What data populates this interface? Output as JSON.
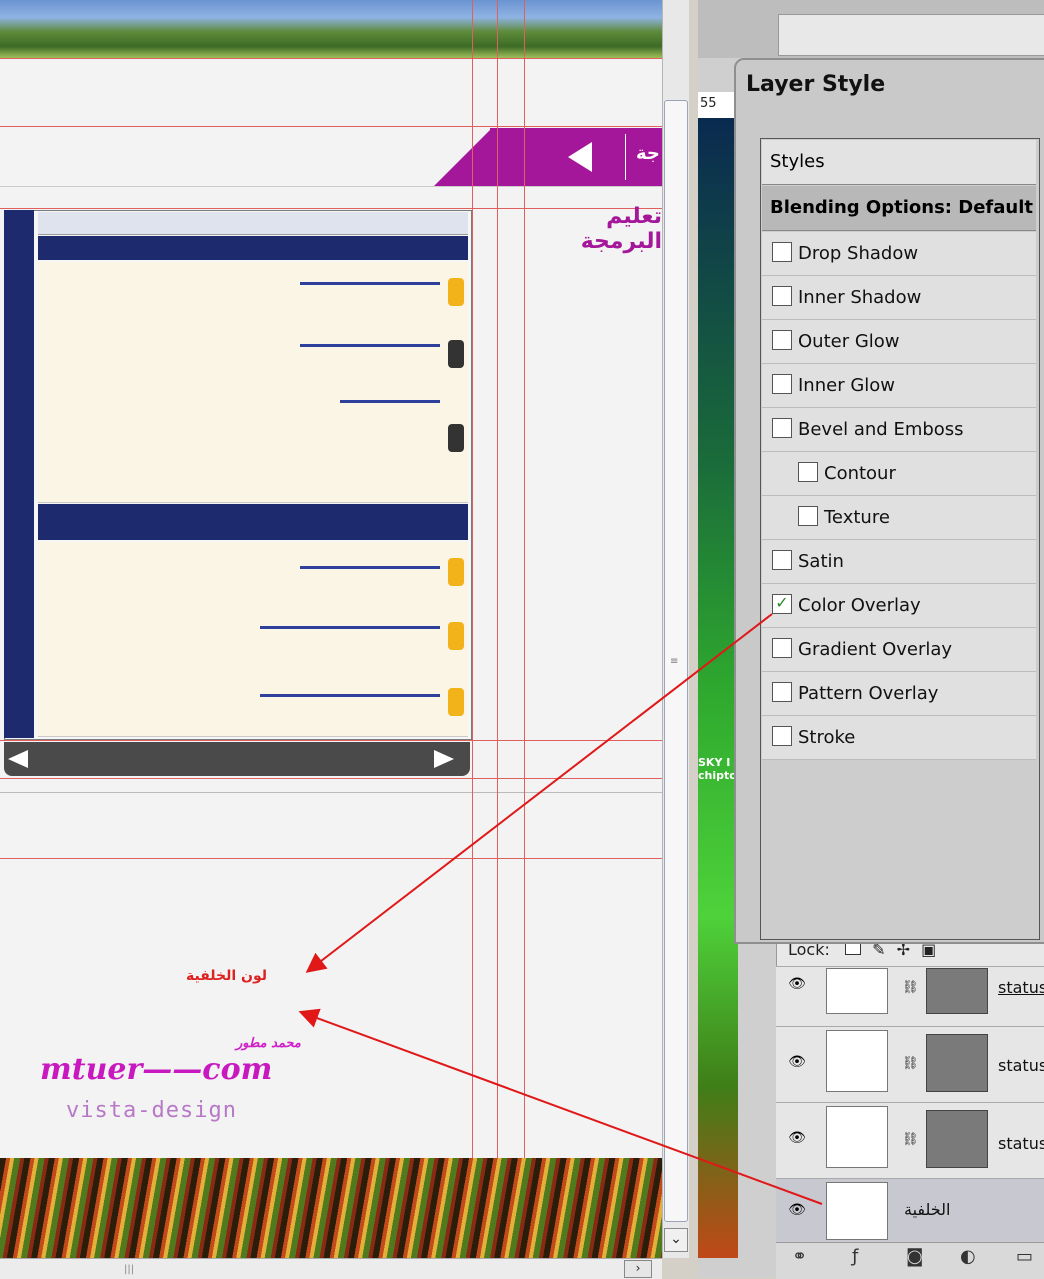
{
  "canvas": {
    "nav_text": "جة",
    "page_title": "تعليم البرمجة",
    "background_label": "لون الخلفية",
    "logo_arabic": "محمد مطور",
    "logo_main": "mtuer——com",
    "logo_sub": "vista-design"
  },
  "document": {
    "ruler_text": "55",
    "art_text": "SKY I\nchipto"
  },
  "dialog": {
    "title": "Layer Style",
    "styles_label": "Styles",
    "blending_label": "Blending Options: Default",
    "options": [
      {
        "label": "Drop Shadow",
        "checked": false,
        "indent": false
      },
      {
        "label": "Inner Shadow",
        "checked": false,
        "indent": false
      },
      {
        "label": "Outer Glow",
        "checked": false,
        "indent": false
      },
      {
        "label": "Inner Glow",
        "checked": false,
        "indent": false
      },
      {
        "label": "Bevel and Emboss",
        "checked": false,
        "indent": false
      },
      {
        "label": "Contour",
        "checked": false,
        "indent": true
      },
      {
        "label": "Texture",
        "checked": false,
        "indent": true
      },
      {
        "label": "Satin",
        "checked": false,
        "indent": false
      },
      {
        "label": "Color Overlay",
        "checked": true,
        "indent": false
      },
      {
        "label": "Gradient Overlay",
        "checked": false,
        "indent": false
      },
      {
        "label": "Pattern Overlay",
        "checked": false,
        "indent": false
      },
      {
        "label": "Stroke",
        "checked": false,
        "indent": false
      }
    ]
  },
  "layers": {
    "lock_label": "Lock:",
    "items": [
      {
        "name": "status",
        "has_mask": true,
        "selected": false
      },
      {
        "name": "status",
        "has_mask": true,
        "selected": false
      },
      {
        "name": "status",
        "has_mask": true,
        "selected": false
      },
      {
        "name": "الخلفية",
        "has_mask": false,
        "selected": true
      }
    ]
  },
  "colors": {
    "accent_purple": "#a5179a",
    "guide_red": "#e06060",
    "arrow_red": "#e01818",
    "check_green": "#2a8a2a"
  }
}
